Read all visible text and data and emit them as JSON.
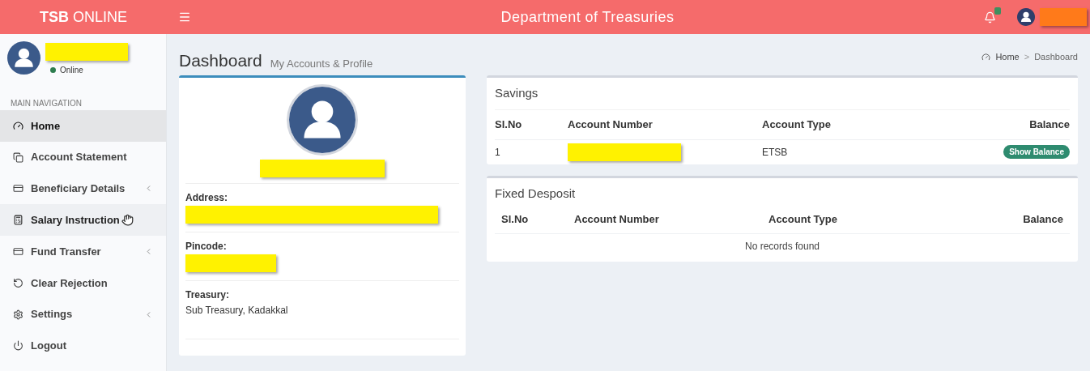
{
  "header": {
    "logo_bold": "TSB",
    "logo_rest": "ONLINE",
    "title": "Department of Treasuries"
  },
  "user_panel": {
    "status": "Online"
  },
  "sidebar": {
    "heading": "MAIN NAVIGATION",
    "items": [
      {
        "label": "Home",
        "selected": true,
        "hovered": false,
        "expandable": false
      },
      {
        "label": "Account Statement",
        "selected": false,
        "hovered": false,
        "expandable": false
      },
      {
        "label": "Beneficiary Details",
        "selected": false,
        "hovered": false,
        "expandable": true
      },
      {
        "label": "Salary Instruction",
        "selected": false,
        "hovered": true,
        "expandable": false
      },
      {
        "label": "Fund Transfer",
        "selected": false,
        "hovered": false,
        "expandable": true
      },
      {
        "label": "Clear Rejection",
        "selected": false,
        "hovered": false,
        "expandable": false
      },
      {
        "label": "Settings",
        "selected": false,
        "hovered": false,
        "expandable": true
      },
      {
        "label": "Logout",
        "selected": false,
        "hovered": false,
        "expandable": false
      }
    ]
  },
  "page": {
    "title": "Dashboard",
    "subtitle": "My Accounts & Profile",
    "breadcrumb": [
      "Home",
      "Dashboard"
    ],
    "breadcrumb_separator": ">"
  },
  "profile": {
    "fields": [
      {
        "label": "Address:",
        "redacted": true
      },
      {
        "label": "Pincode:",
        "redacted": true
      },
      {
        "label": "Treasury:",
        "value": "Sub Treasury, Kadakkal"
      }
    ]
  },
  "savings": {
    "title": "Savings",
    "columns": [
      "Sl.No",
      "Account Number",
      "Account Type",
      "Balance"
    ],
    "rows": [
      {
        "sl_no": "1",
        "account_type": "ETSB",
        "action": "Show Balance"
      }
    ]
  },
  "fixed_deposit": {
    "title": "Fixed Desposit",
    "columns": [
      "Sl.No",
      "Account Number",
      "Account Type",
      "Balance"
    ],
    "empty": "No records found"
  }
}
